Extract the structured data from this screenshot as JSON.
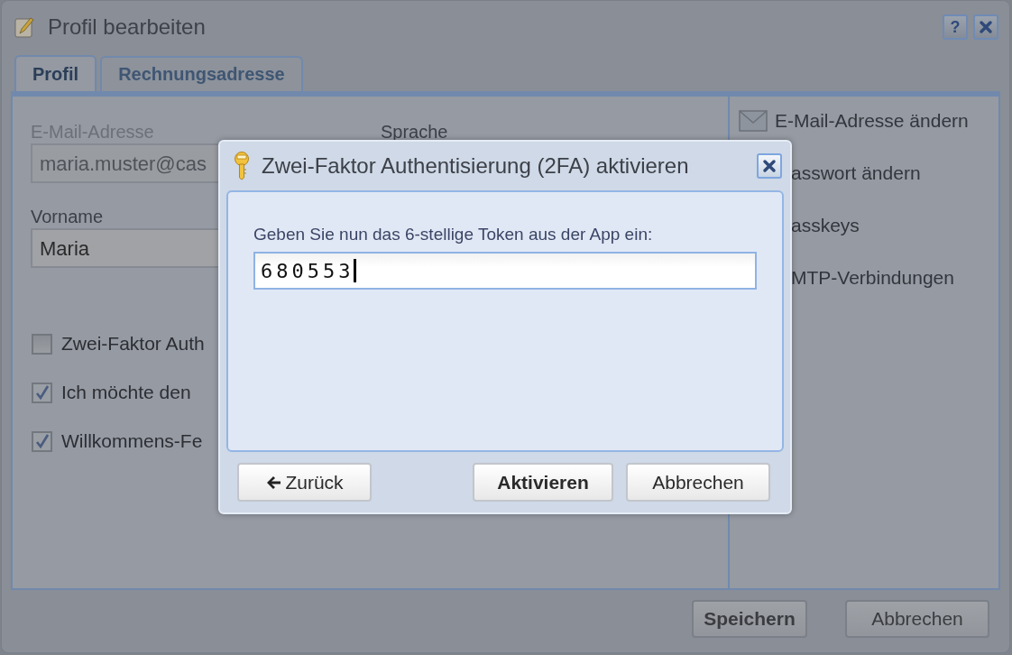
{
  "window": {
    "title": "Profil bearbeiten",
    "buttons": [
      {
        "kind": "help",
        "label": "?"
      },
      {
        "kind": "close"
      }
    ]
  },
  "tabs": [
    {
      "label": "Profil",
      "selected": true
    },
    {
      "label": "Rechnungsadresse",
      "selected": false
    }
  ],
  "form": {
    "fields": [
      {
        "label": "E-Mail-Adresse",
        "value": "maria.muster@cas",
        "disabled": true
      },
      {
        "label": "Vorname",
        "value": "Maria",
        "disabled": false
      }
    ],
    "column_2_label": "Sprache",
    "checkboxes": [
      {
        "label": "Zwei-Faktor Auth",
        "checked": false
      },
      {
        "label": "Ich möchte den",
        "checked": true
      },
      {
        "label": "Willkommens-Fe",
        "checked": true
      }
    ]
  },
  "sidebar": {
    "items": [
      {
        "kind": "mail",
        "label": "E-Mail-Adresse ändern"
      },
      {
        "kind": "covered",
        "label": "asswort ändern"
      },
      {
        "kind": "covered",
        "label": "asskeys"
      },
      {
        "kind": "covered",
        "label": "MTP-Verbindungen"
      }
    ]
  },
  "footer": {
    "buttons": [
      {
        "label": "Speichern",
        "primary": true
      },
      {
        "label": "Abbrechen",
        "primary": false
      }
    ]
  },
  "dialog": {
    "title": "Zwei-Faktor Authentisierung (2FA) aktivieren",
    "prompt": "Geben Sie nun das 6-stellige Token aus der App ein:",
    "token": "680553",
    "buttons": [
      {
        "kind": "back",
        "label": "Zurück",
        "primary": false
      },
      {
        "kind": "submit",
        "label": "Aktivieren",
        "primary": true
      },
      {
        "kind": "cancel",
        "label": "Abbrechen",
        "primary": false
      }
    ]
  }
}
